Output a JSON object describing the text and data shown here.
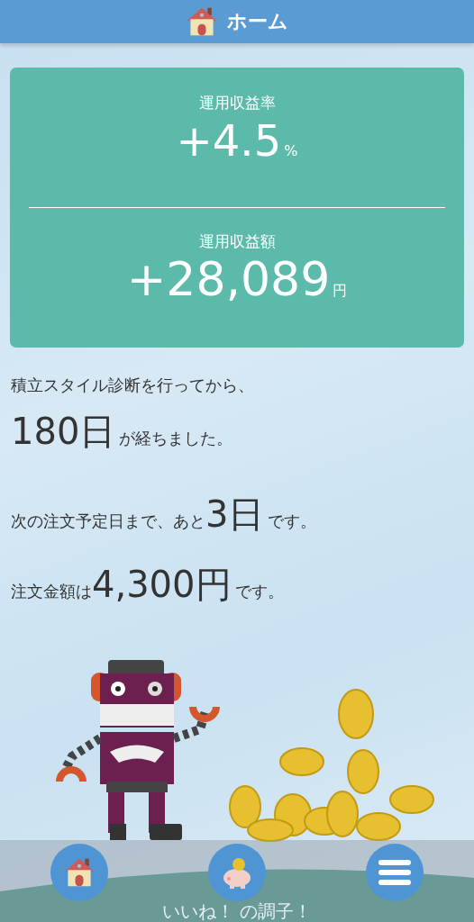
{
  "header": {
    "title": "ホーム"
  },
  "summary": [
    {
      "label": "運用収益率",
      "value": "+4.5",
      "unit": "%"
    },
    {
      "label": "運用収益額",
      "value": "+28,089",
      "unit": "円"
    }
  ],
  "messages": [
    {
      "prefix": "積立スタイル診断を行ってから、"
    },
    {
      "value": "180日",
      "suffix": "が経ちました。"
    },
    {
      "prefix": "次の注文予定日まで、あと",
      "value": "3日",
      "suffix": "です。"
    },
    {
      "prefix": "注文金額は",
      "value": "4,300円",
      "suffix": "です。"
    }
  ],
  "status_message": "いいね！ の調子！",
  "nav": [
    {
      "kind": "home"
    },
    {
      "kind": "piggy"
    },
    {
      "kind": "menu"
    }
  ]
}
